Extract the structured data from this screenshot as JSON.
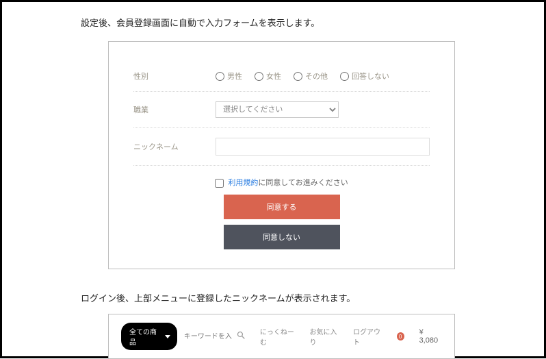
{
  "caption1": "設定後、会員登録画面に自動で入力フォームを表示します。",
  "form": {
    "gender": {
      "label": "性別",
      "options": [
        "男性",
        "女性",
        "その他",
        "回答しない"
      ]
    },
    "occupation": {
      "label": "職業",
      "placeholder": "選択してください"
    },
    "nickname": {
      "label": "ニックネーム"
    },
    "agree": {
      "link": "利用規約",
      "suffix": "に同意してお進みください"
    },
    "buttons": {
      "agree": "同意する",
      "disagree": "同意しない"
    }
  },
  "caption2": "ログイン後、上部メニューに登録したニックネームが表示されます。",
  "header": {
    "category": "全ての商品",
    "search_placeholder": "キーワードを入",
    "nickname": "にっくねーむ",
    "favorite": "お気に入り",
    "logout": "ログアウト",
    "badge_count": "0",
    "price": "¥ 3,080"
  }
}
